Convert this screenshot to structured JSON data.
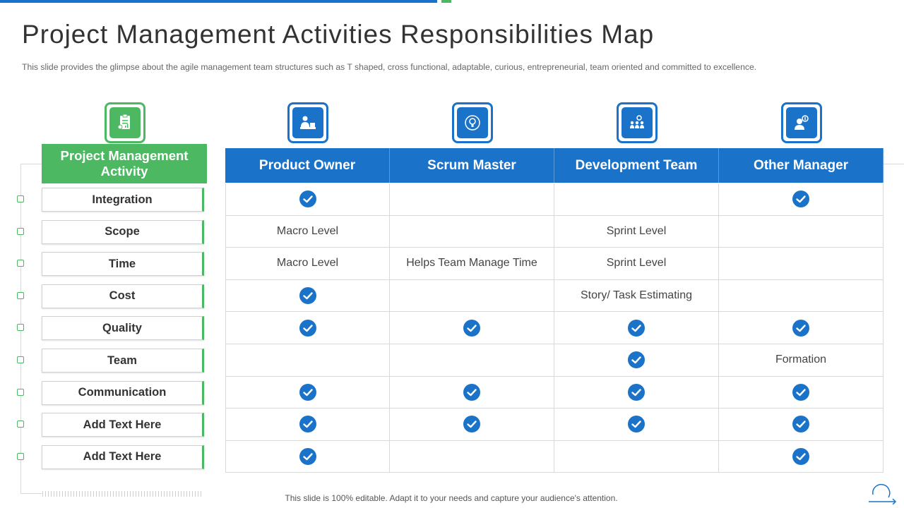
{
  "title": "Project Management Activities Responsibilities Map",
  "subtitle": "This slide provides  the glimpse about the agile management  team structures such as T shaped, cross functional,  adaptable,  curious,  entrepreneurial,  team oriented  and committed to excellence.",
  "footer": "This slide is 100% editable. Adapt it to your needs and capture your audience's attention.",
  "colors": {
    "blue": "#1a73c8",
    "green": "#4cb862"
  },
  "icons": [
    "clipboard-chart-icon",
    "owner-desk-icon",
    "bulb-badge-icon",
    "team-gear-icon",
    "manager-money-icon"
  ],
  "activity_header": "Project Management Activity",
  "activities": [
    "Integration",
    "Scope",
    "Time",
    "Cost",
    "Quality",
    "Team",
    "Communication",
    "Add Text  Here",
    "Add Text  Here"
  ],
  "columns": [
    "Product Owner",
    "Scrum Master",
    "Development Team",
    "Other Manager"
  ],
  "rows": [
    [
      "check",
      "",
      "",
      "check"
    ],
    [
      "Macro Level",
      "",
      "Sprint Level",
      ""
    ],
    [
      "Macro Level",
      "Helps Team Manage Time",
      "Sprint Level",
      ""
    ],
    [
      "check",
      "",
      "Story/ Task Estimating",
      ""
    ],
    [
      "check",
      "check",
      "check",
      "check"
    ],
    [
      "",
      "",
      "check",
      "Formation"
    ],
    [
      "check",
      "check",
      "check",
      "check"
    ],
    [
      "check",
      "check",
      "check",
      "check"
    ],
    [
      "check",
      "",
      "",
      "check"
    ]
  ]
}
